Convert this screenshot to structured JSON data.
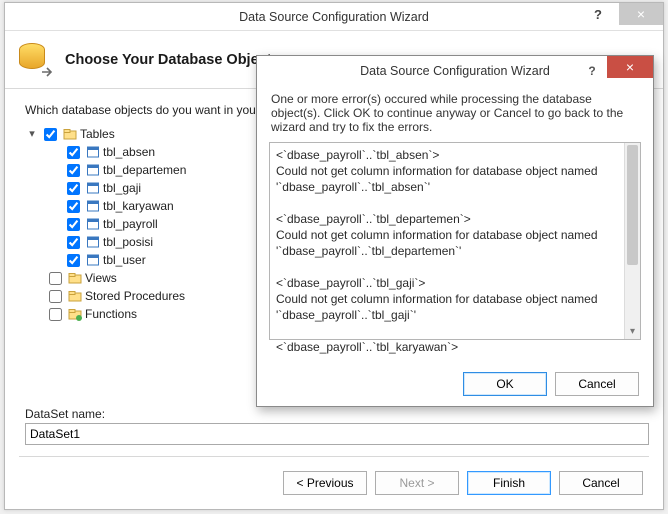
{
  "window": {
    "title": "Data Source Configuration Wizard",
    "help": "?",
    "close": "×"
  },
  "header": {
    "title": "Choose Your Database Objects"
  },
  "content": {
    "prompt": "Which database objects do you want in your dataset?"
  },
  "tree": {
    "root": {
      "label": "Tables",
      "checked": true,
      "expanded": true
    },
    "tables": [
      {
        "label": "tbl_absen",
        "checked": true
      },
      {
        "label": "tbl_departemen",
        "checked": true
      },
      {
        "label": "tbl_gaji",
        "checked": true
      },
      {
        "label": "tbl_karyawan",
        "checked": true
      },
      {
        "label": "tbl_payroll",
        "checked": true
      },
      {
        "label": "tbl_posisi",
        "checked": true
      },
      {
        "label": "tbl_user",
        "checked": true
      }
    ],
    "other": [
      {
        "label": "Views",
        "checked": false
      },
      {
        "label": "Stored Procedures",
        "checked": false
      },
      {
        "label": "Functions",
        "checked": false
      }
    ]
  },
  "dataset": {
    "label": "DataSet name:",
    "value": "DataSet1"
  },
  "footer": {
    "prev": "< Previous",
    "next": "Next >",
    "finish": "Finish",
    "cancel": "Cancel"
  },
  "error": {
    "title": "Data Source Configuration Wizard",
    "help": "?",
    "close": "×",
    "message": "One or more error(s) occured while processing the database object(s). Click OK to continue anyway or Cancel to go back to the wizard and try to fix the errors.",
    "body": "<`dbase_payroll`..`tbl_absen`>\nCould not get column information for database object named '`dbase_payroll`..`tbl_absen`'\n\n<`dbase_payroll`..`tbl_departemen`>\nCould not get column information for database object named '`dbase_payroll`..`tbl_departemen`'\n\n<`dbase_payroll`..`tbl_gaji`>\nCould not get column information for database object named '`dbase_payroll`..`tbl_gaji`'\n\n<`dbase_payroll`..`tbl_karyawan`>",
    "ok": "OK",
    "cancel": "Cancel"
  }
}
